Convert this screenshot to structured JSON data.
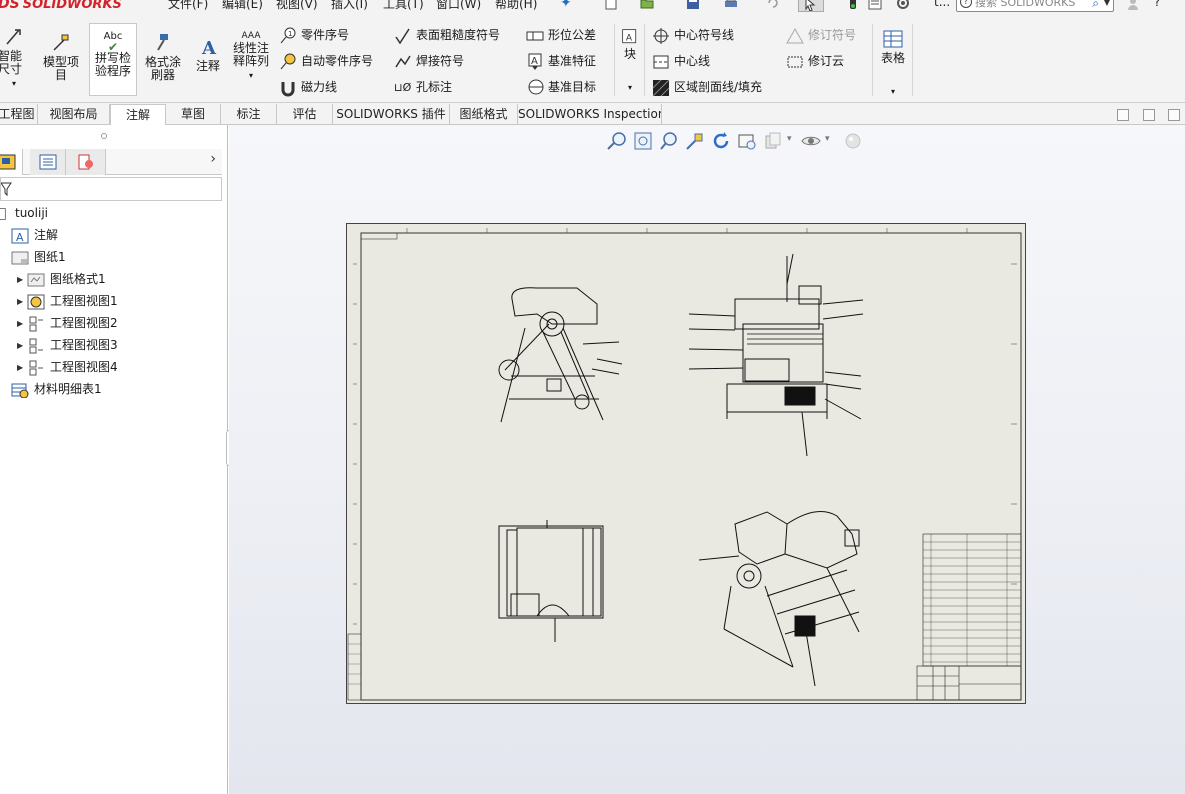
{
  "app": {
    "logo_ds": "DS",
    "logo_name": "SOLIDWORKS",
    "menus": [
      "文件(F)",
      "编辑(E)",
      "视图(V)",
      "插入(I)",
      "工具(T)",
      "窗口(W)",
      "帮助(H)"
    ],
    "search_placeholder": "搜索 SOLIDWORKS",
    "overflow_label": "t...",
    "help_label": "?"
  },
  "ribbon": {
    "smart_dimension": "智能尺寸",
    "model_items": "模型项目",
    "spell_checker": "拼写检验程序",
    "format_painter": "格式涂刷器",
    "note": "注释",
    "linear_note_pattern": "线性注释阵列",
    "col1": [
      "零件序号",
      "自动零件序号",
      "磁力线"
    ],
    "col2": [
      "表面粗糙度符号",
      "焊接符号",
      "孔标注"
    ],
    "col3": [
      "形位公差",
      "基准特征",
      "基准目标"
    ],
    "block": "块",
    "col4": [
      "中心符号线",
      "中心线",
      "区域剖面线/填充"
    ],
    "col5": [
      "修订符号",
      "修订云"
    ],
    "table": "表格",
    "abc": "Abc",
    "aaa": "AAA",
    "hole_prefix": "⊔Ø"
  },
  "tabs": [
    "工程图",
    "视图布局",
    "注解",
    "草图",
    "标注",
    "评估",
    "SOLIDWORKS 插件",
    "图纸格式",
    "SOLIDWORKS Inspection"
  ],
  "active_tab": "注解",
  "tree": {
    "root": "tuoliji",
    "items": [
      {
        "label": "注解",
        "level": 1
      },
      {
        "label": "图纸1",
        "level": 1
      },
      {
        "label": "图纸格式1",
        "level": 2
      },
      {
        "label": "工程图视图1",
        "level": 2
      },
      {
        "label": "工程图视图2",
        "level": 2
      },
      {
        "label": "工程图视图3",
        "level": 2
      },
      {
        "label": "工程图视图4",
        "level": 2
      },
      {
        "label": "材料明细表1",
        "level": 1
      }
    ]
  },
  "colors": {
    "accent": "#1e6fc8",
    "logo": "#d2232a",
    "sheet": "#eae9e1",
    "ribbon_bg": "#f3f3f3"
  }
}
